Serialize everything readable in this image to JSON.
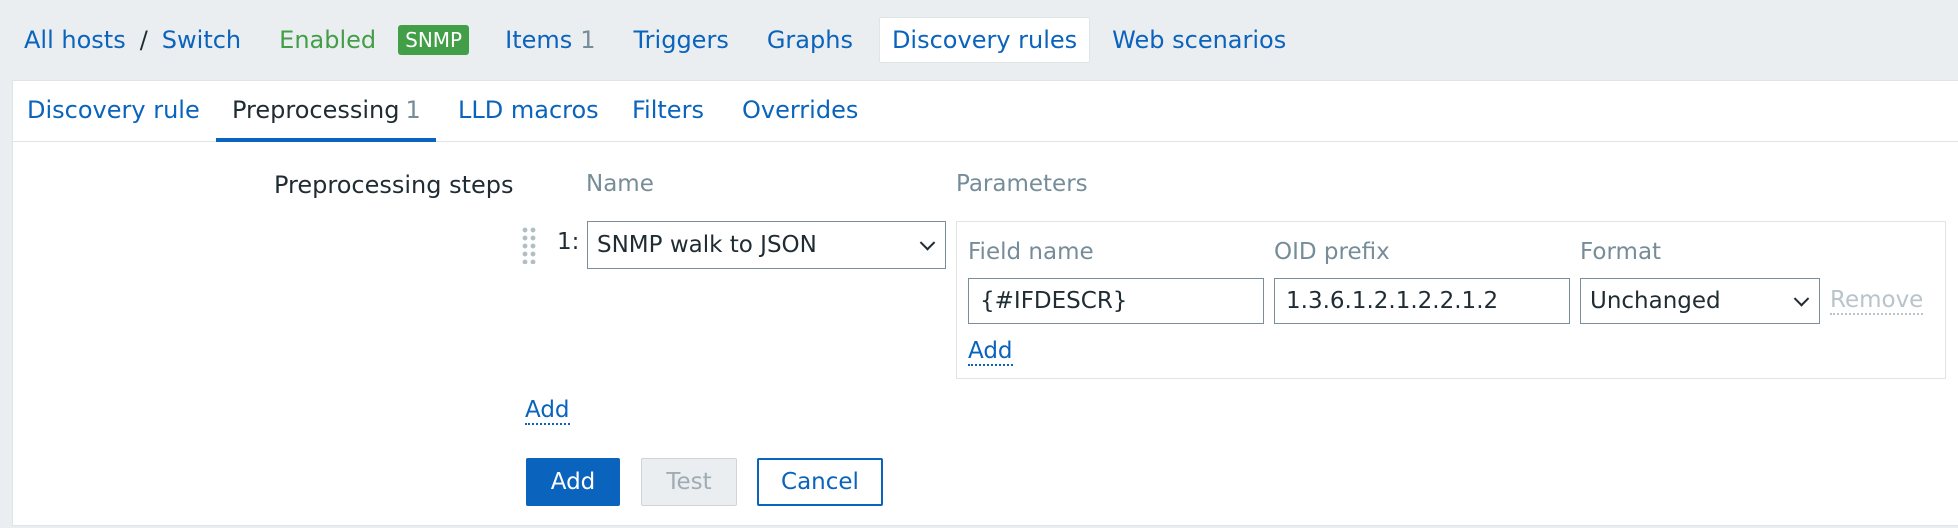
{
  "hostnav": {
    "all_hosts": "All hosts",
    "separator": "/",
    "host": "Switch",
    "status": "Enabled",
    "badge": "SNMP",
    "items_label": "Items",
    "items_count": "1",
    "triggers": "Triggers",
    "graphs": "Graphs",
    "discovery_rules": "Discovery rules",
    "web_scenarios": "Web scenarios"
  },
  "tabs": [
    {
      "label": "Discovery rule",
      "count": ""
    },
    {
      "label": "Preprocessing",
      "count": "1"
    },
    {
      "label": "LLD macros",
      "count": ""
    },
    {
      "label": "Filters",
      "count": ""
    },
    {
      "label": "Overrides",
      "count": ""
    }
  ],
  "active_tab": "Preprocessing",
  "form": {
    "steps_label": "Preprocessing steps",
    "col_name": "Name",
    "col_parameters": "Parameters",
    "step": {
      "number": "1:",
      "name": "SNMP walk to JSON",
      "params": {
        "field_name_head": "Field name",
        "oid_prefix_head": "OID prefix",
        "format_head": "Format",
        "field_name": "{#IFDESCR}",
        "oid_prefix": "1.3.6.1.2.1.2.2.1.2",
        "format": "Unchanged",
        "remove": "Remove",
        "add": "Add"
      }
    },
    "add_step": "Add"
  },
  "buttons": {
    "add": "Add",
    "test": "Test",
    "cancel": "Cancel"
  },
  "colors": {
    "link": "#0a63bc",
    "enabled": "#429e47",
    "muted": "#768d99"
  }
}
